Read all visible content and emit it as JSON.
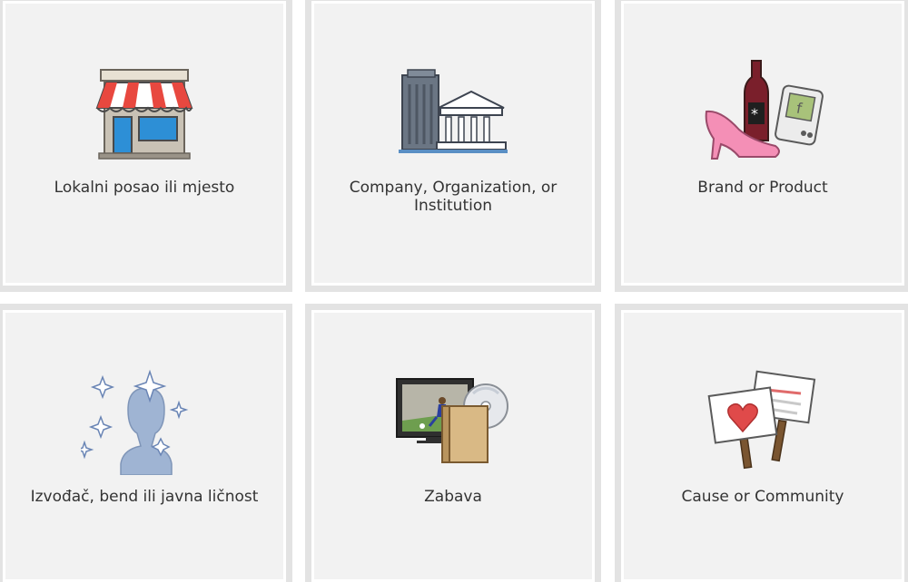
{
  "categories": [
    {
      "label": "Lokalni posao ili mjesto",
      "icon": "storefront-icon"
    },
    {
      "label": "Company, Organization, or Institution",
      "icon": "buildings-icon"
    },
    {
      "label": "Brand or Product",
      "icon": "products-icon"
    },
    {
      "label": "Izvođač, bend ili javna ličnost",
      "icon": "public-figure-icon"
    },
    {
      "label": "Zabava",
      "icon": "entertainment-icon"
    },
    {
      "label": "Cause or Community",
      "icon": "signs-icon"
    }
  ],
  "colors": {
    "tile_background": "#f2f2f2",
    "tile_border": "#e3e3e3",
    "label_text": "#333333"
  }
}
